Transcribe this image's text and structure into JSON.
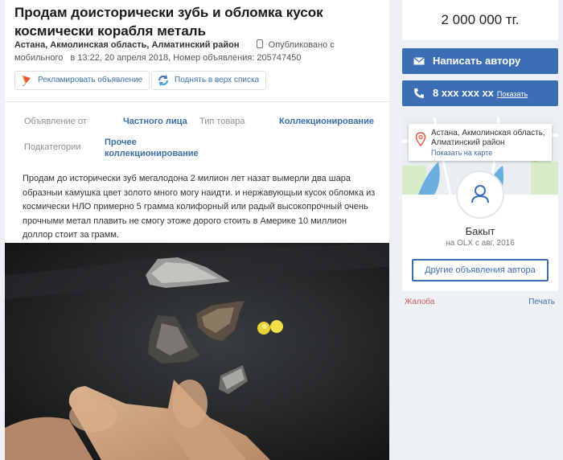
{
  "ad": {
    "title": "Продам доисторически зубь и обломка кусок космически корабля металь",
    "location": "Астана, Акмолинская область, Алматинский район",
    "published_mobile": "Опубликовано с мобильного",
    "published_time": "в 13:22, 20 апреля 2018, Номер объявления: 205747450"
  },
  "promo": {
    "advertise_label": "Рекламировать объявление",
    "raise_label": "Поднять в верх списка"
  },
  "params": {
    "ad_from_label": "Объявление от",
    "ad_from_value": "Частного лица",
    "item_type_label": "Тип товара",
    "item_type_value": "Коллекционирование",
    "subcategory_label": "Подкатегории",
    "subcategory_value_line1": "Прочее",
    "subcategory_value_line2": "коллекционирование"
  },
  "description": "Продам до исторически зуб мегалодона 2 милион лет назат вымерли два шара образныи камушка цвет золото много могу наидти. и нержавующыи кусок обломка из космически НЛО примерно 5 грамма колифорный или радый высокопрочный очень прочными метал плавить не смогу этоже дорого стоить в Америке 10 миллион доллор стоит за грамм.",
  "sidebar": {
    "price": "2 000 000 тг.",
    "write_author": "Написать автору",
    "phone": "8 ххх ххх хх",
    "show_phone": "Показать",
    "map_address": "Астана, Акмолинская область, Алматинский район",
    "show_on_map": "Показать на карте",
    "user_name": "Бакыт",
    "user_since": "на OLX с авг. 2016",
    "other_ads": "Другие объявления автора",
    "complain": "Жалоба",
    "print": "Печать"
  },
  "colors": {
    "accent_blue": "#3b6eb4",
    "link_blue": "#3a6fa8",
    "complain_red": "#c85a5a"
  },
  "icons": {
    "phone": "mobile-phone-icon",
    "advertise": "kite-icon",
    "raise": "refresh-arrows-icon",
    "envelope": "envelope-icon",
    "call": "phone-handset-icon",
    "pin": "map-pin-icon",
    "avatar": "user-icon"
  }
}
